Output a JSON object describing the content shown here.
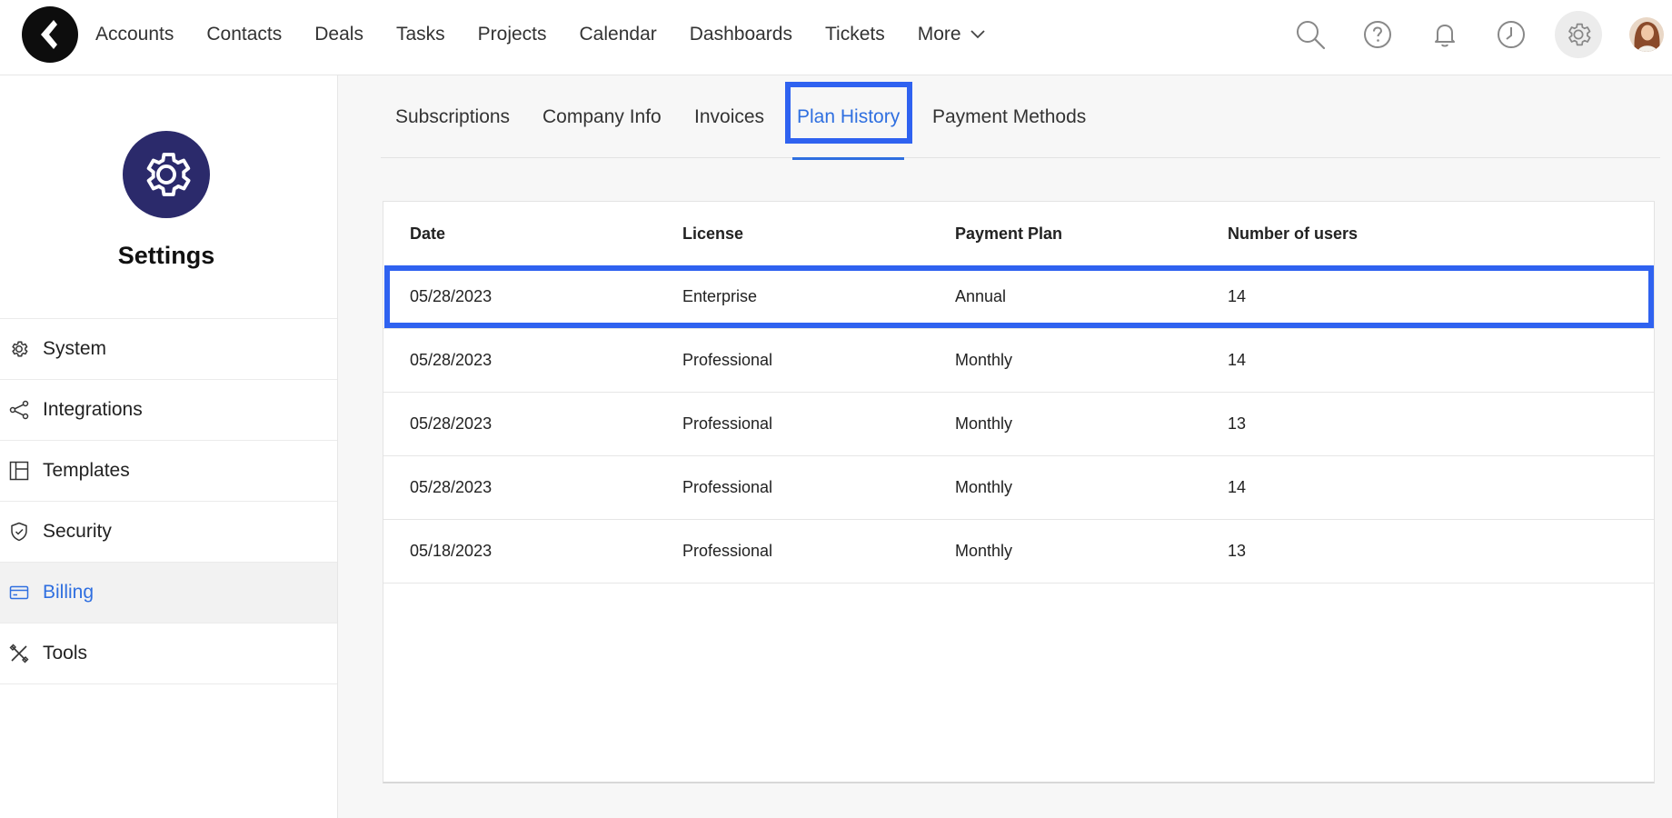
{
  "topnav": {
    "items": [
      "Accounts",
      "Contacts",
      "Deals",
      "Tasks",
      "Projects",
      "Calendar",
      "Dashboards",
      "Tickets"
    ],
    "more_label": "More"
  },
  "icons": {
    "search": "search-icon",
    "help": "help-icon",
    "notifications": "bell-icon",
    "history": "clock-icon",
    "settings": "gear-icon"
  },
  "colors": {
    "accent": "#2f6fe0",
    "highlight_border": "#2f62f0",
    "settings_badge": "#2b2a6b"
  },
  "sidebar": {
    "title": "Settings",
    "items": [
      {
        "label": "System",
        "icon": "gear-icon"
      },
      {
        "label": "Integrations",
        "icon": "share-icon"
      },
      {
        "label": "Templates",
        "icon": "template-icon"
      },
      {
        "label": "Security",
        "icon": "shield-icon"
      },
      {
        "label": "Billing",
        "icon": "credit-card-icon",
        "active": true
      },
      {
        "label": "Tools",
        "icon": "tools-icon"
      }
    ]
  },
  "tabs": {
    "items": [
      "Subscriptions",
      "Company Info",
      "Invoices",
      "Plan History",
      "Payment Methods"
    ],
    "active": "Plan History"
  },
  "table": {
    "columns": [
      "Date",
      "License",
      "Payment Plan",
      "Number of users"
    ],
    "rows": [
      [
        "05/28/2023",
        "Enterprise",
        "Annual",
        "14"
      ],
      [
        "05/28/2023",
        "Professional",
        "Monthly",
        "14"
      ],
      [
        "05/28/2023",
        "Professional",
        "Monthly",
        "13"
      ],
      [
        "05/28/2023",
        "Professional",
        "Monthly",
        "14"
      ],
      [
        "05/18/2023",
        "Professional",
        "Monthly",
        "13"
      ]
    ]
  }
}
